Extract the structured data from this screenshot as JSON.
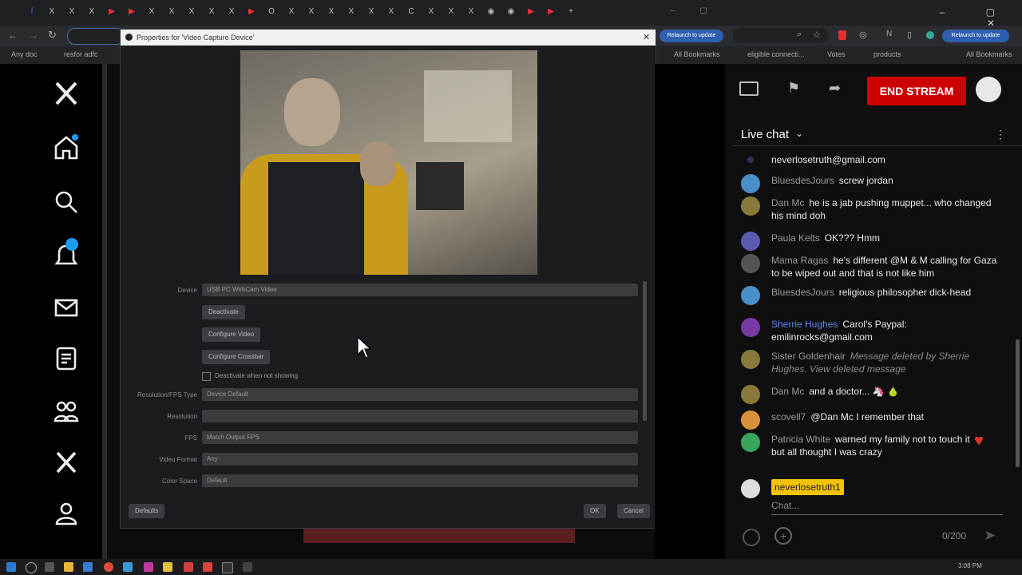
{
  "browser": {
    "update_label": "Relaunch to update",
    "bookmarks": [
      "Any doc",
      "resfor adfc",
      "All Bookmarks",
      "eligible connecti...",
      "Votes",
      "products",
      "All Bookmarks"
    ],
    "tab_icons": [
      "f",
      "X",
      "X",
      "X",
      "▶",
      "▶",
      "X",
      "X",
      "X",
      "X",
      "X",
      "▶",
      "O",
      "X",
      "X",
      "X",
      "X",
      "X",
      "X",
      "C",
      "X",
      "X",
      "X",
      "◉",
      "◉",
      "▶",
      "▶",
      "+"
    ]
  },
  "dialog": {
    "title": "Properties for 'Video Capture Device'",
    "fields": [
      {
        "label": "Device",
        "value": "USB PC WebCam Video"
      },
      {
        "label": "Resolution/FPS Type",
        "value": "Device Default"
      },
      {
        "label": "Resolution",
        "value": ""
      },
      {
        "label": "FPS",
        "value": "Match Output FPS"
      },
      {
        "label": "Video Format",
        "value": "Any"
      },
      {
        "label": "Color Space",
        "value": "Default"
      }
    ],
    "buttons": {
      "deactivate": "Deactivate",
      "configure_video": "Configure Video",
      "configure_crossbar": "Configure Crossbar",
      "defaults": "Defaults",
      "ok": "OK",
      "cancel": "Cancel"
    },
    "checkbox_label": "Deactivate when not showing"
  },
  "youtube": {
    "end_stream": "END STREAM",
    "live_chat_title": "Live chat",
    "messages": [
      {
        "author": "",
        "text": "neverlosetruth@gmail.com",
        "avatar_color": "#3b2a5a"
      },
      {
        "author": "BluesdesJours",
        "text": "screw jordan",
        "avatar_color": "#4a8fc7"
      },
      {
        "author": "Dan Mc",
        "text": "he is a jab pushing muppet... who changed his mind doh",
        "avatar_color": "#8a7a3a"
      },
      {
        "author": "Paula Kelts",
        "text": "OK??? Hmm",
        "avatar_color": "#5a5ab0"
      },
      {
        "author": "Mama Ragas",
        "text": "he's different @M & M calling for Gaza to be wiped out and that is not like him",
        "avatar_color": "#555"
      },
      {
        "author": "BluesdesJours",
        "text": "religious philosopher dick-head",
        "avatar_color": "#4a8fc7"
      },
      {
        "author": "Sherrie Hughes",
        "text": "Carol's Paypal: emilinrocks@gmail.com",
        "avatar_color": "#7a3aa5"
      },
      {
        "author": "Sister Goldenhair",
        "text": "Message deleted by Sherrie Hughes. View deleted message",
        "avatar_color": "#8a7a3a"
      },
      {
        "author": "Dan Mc",
        "text": "and a doctor... 🦄 🍐",
        "avatar_color": "#8a7a3a"
      },
      {
        "author": "scovell7",
        "text": "@Dan Mc I remember that",
        "avatar_color": "#d9903a"
      },
      {
        "author": "Patricia White",
        "text": "warned my family not to touch it but all thought I was crazy",
        "avatar_color": "#3aa55a"
      }
    ],
    "input_user": "neverlosetruth1",
    "input_placeholder": "Chat...",
    "char_count": "0/200"
  },
  "taskbar": {
    "clock": "3:08 PM"
  }
}
